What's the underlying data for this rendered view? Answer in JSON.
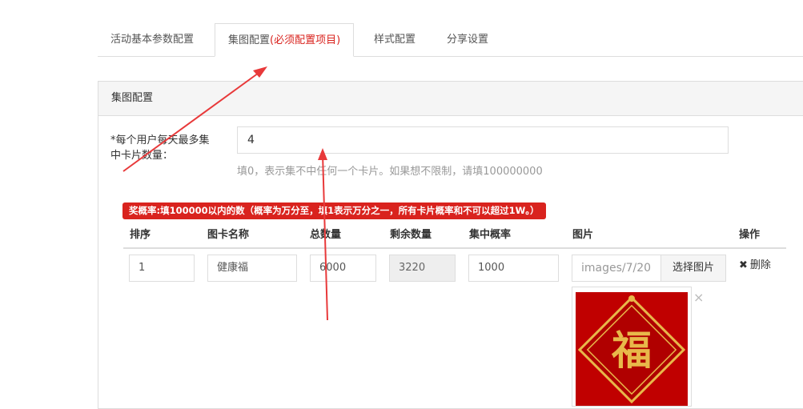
{
  "tabs": [
    {
      "label": "活动基本参数配置",
      "active": false
    },
    {
      "label": "集图配置",
      "required_note": "(必须配置项目)",
      "active": true
    },
    {
      "label": "样式配置",
      "active": false
    },
    {
      "label": "分享设置",
      "active": false
    }
  ],
  "panel": {
    "title": "集图配置"
  },
  "daily_limit": {
    "label_line1": "*每个用户每天最多集",
    "label_line2": "中卡片数量：",
    "value": "4",
    "help": "填0，表示集不中任何一个卡片。如果想不限制，请填100000000"
  },
  "probability_note": "奖概率:填100000以内的数（概率为万分至，填1表示万分之一，所有卡片概率和不可以超过1W。）",
  "table": {
    "headers": [
      "排序",
      "图卡名称",
      "总数量",
      "剩余数量",
      "集中概率",
      "图片",
      "操作"
    ],
    "rows": [
      {
        "order": "1",
        "name": "健康福",
        "total": "6000",
        "remaining": "3220",
        "probability": "1000",
        "image_path": "images/7/20",
        "pick_label": "选择图片",
        "delete_label": "删除"
      }
    ]
  },
  "thumbnail": {
    "close_glyph": "×",
    "character": "福"
  },
  "colors": {
    "accent_red": "#d9231e",
    "card_red": "#c00000",
    "gold": "#e8b84a"
  },
  "icons": {
    "delete": "close-icon",
    "thumbnail_close": "close-icon"
  }
}
